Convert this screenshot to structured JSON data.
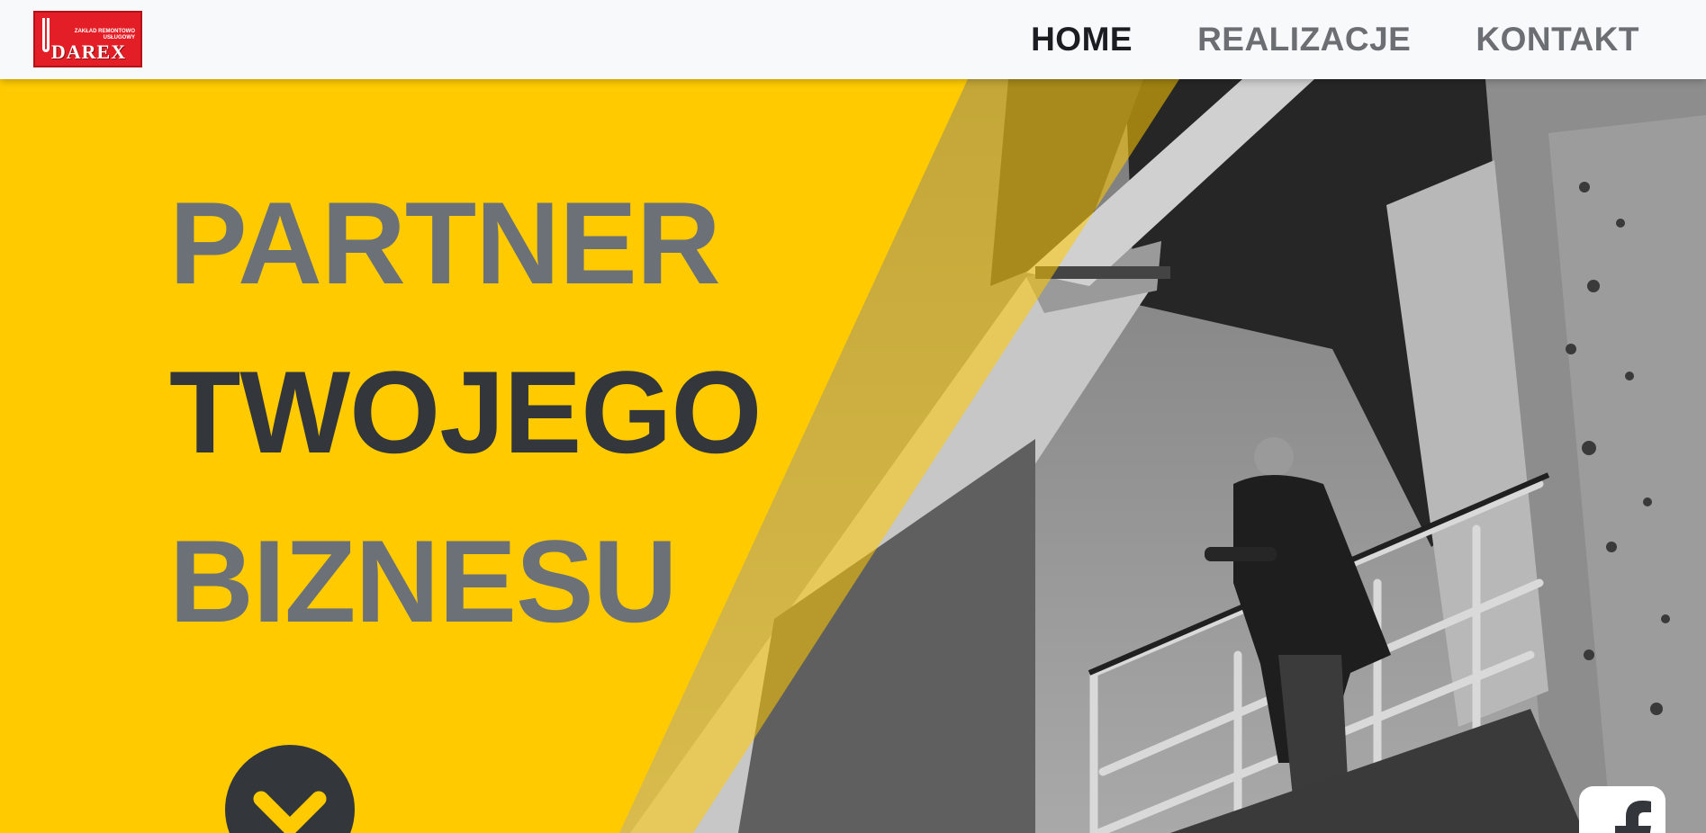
{
  "brand": {
    "logo_name": "DAREX",
    "logo_tagline": "ZAKŁAD REMONTOWO USŁUGOWY"
  },
  "nav": {
    "items": [
      {
        "label": "HOME",
        "active": true
      },
      {
        "label": "REALIZACJE",
        "active": false
      },
      {
        "label": "KONTAKT",
        "active": false
      }
    ]
  },
  "hero": {
    "line1": "PARTNER",
    "line2": "TWOJEGO",
    "line3": "BIZNESU",
    "scroll_icon": "chevron-down-icon"
  },
  "social": {
    "icon": "facebook-icon"
  },
  "colors": {
    "accent_yellow": "#ffcb00",
    "text_dark": "#33363b",
    "text_grey": "#6c7177",
    "nav_bg": "#f8f9fa",
    "logo_red": "#e41e26"
  }
}
